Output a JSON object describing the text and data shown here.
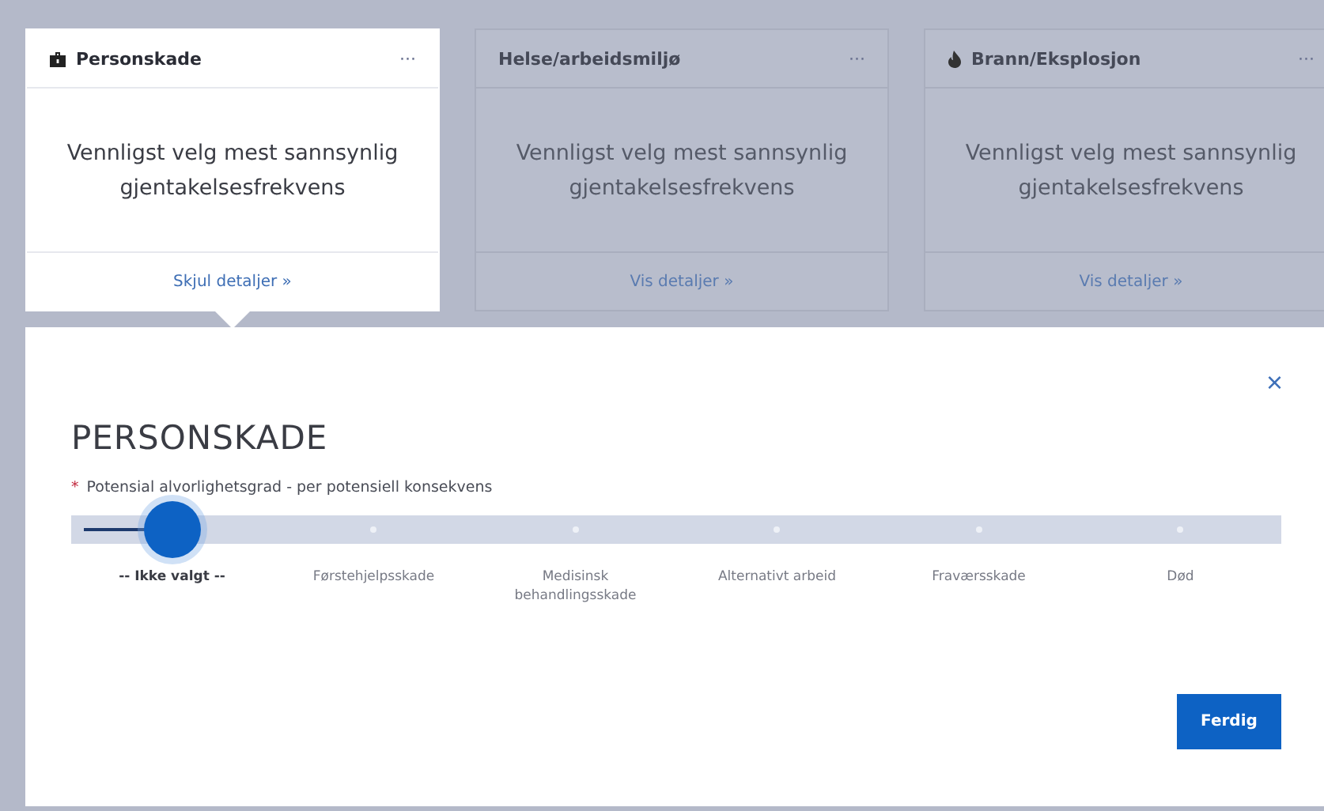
{
  "cards": [
    {
      "title": "Personskade",
      "kind": "case",
      "active": true,
      "menu": "···",
      "body": "Vennligst velg mest sannsynlig gjentakelsesfrekvens",
      "link": "Skjul detaljer »"
    },
    {
      "title": "Helse/arbeidsmiljø",
      "active": false,
      "menu": "···",
      "body": "Vennligst velg mest sannsynlig gjentakelsesfrekvens",
      "link": "Vis detaljer »"
    },
    {
      "title": "Brann/Eksplosjon",
      "kind": "flame",
      "active": false,
      "menu": "···",
      "body": "Vennligst velg mest sannsynlig gjentakelsesfrekvens",
      "link": "Vis detaljer »"
    }
  ],
  "panel": {
    "close": "×",
    "title": "PERSONSKADE",
    "required_mark": "*",
    "field_label": "Potensial alvorlighetsgrad - per potensiell konsekvens",
    "stops": [
      {
        "label": "-- Ikke valgt --",
        "selected": true
      },
      {
        "label": "Førstehjelpsskade",
        "selected": false
      },
      {
        "label": "Medisinsk behandlingsskade",
        "selected": false
      },
      {
        "label": "Alternativt arbeid",
        "selected": false
      },
      {
        "label": "Fraværsskade",
        "selected": false
      },
      {
        "label": "Død",
        "selected": false
      }
    ],
    "done_button": "Ferdig"
  }
}
